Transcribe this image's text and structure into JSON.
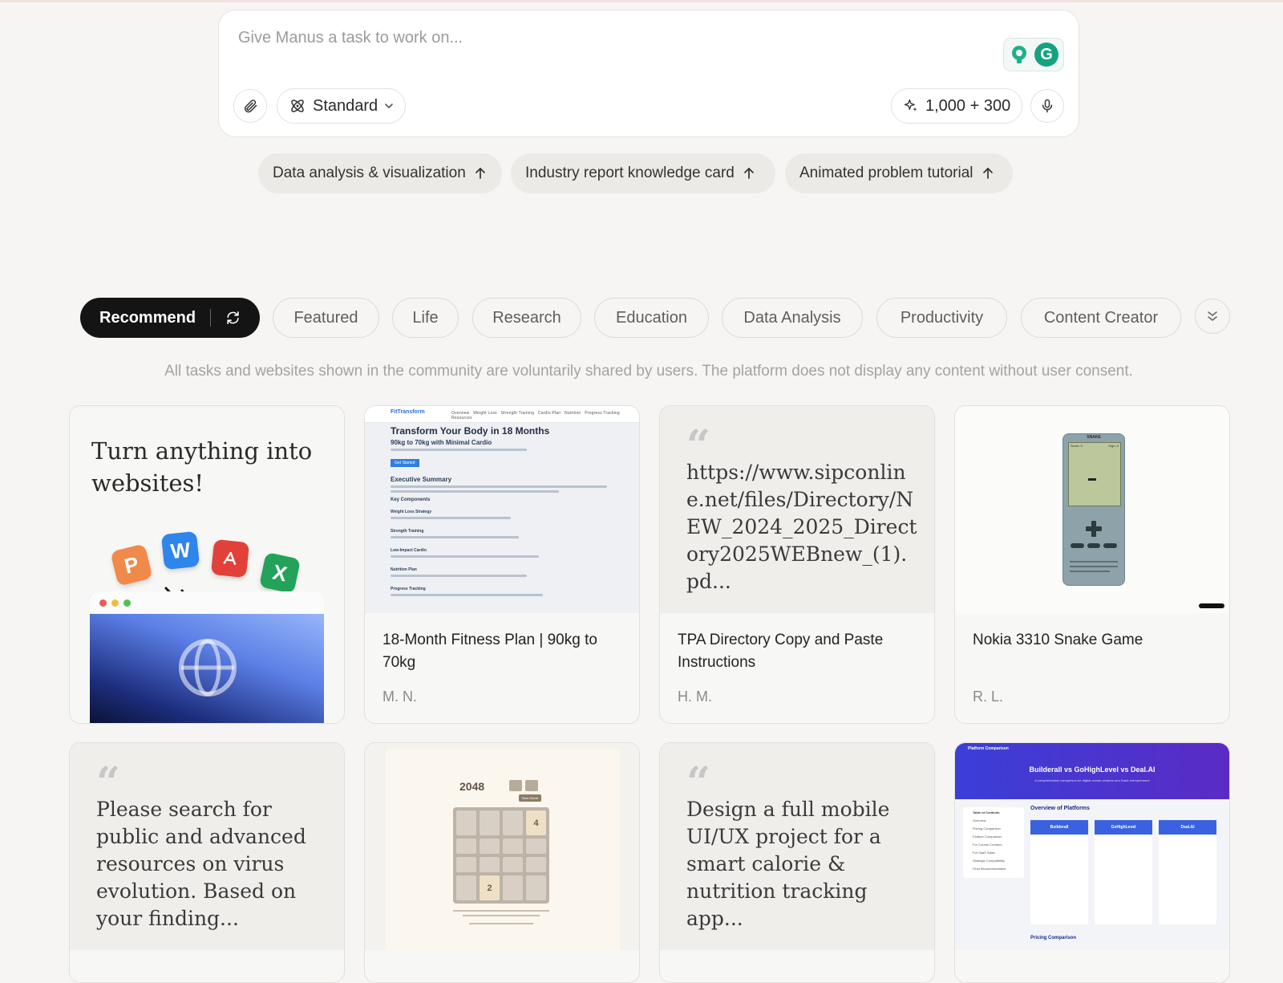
{
  "task_box": {
    "placeholder": "Give Manus a task to work on...",
    "mode_label": "Standard",
    "credits_label": "1,000 + 300"
  },
  "suggestions": [
    {
      "label": "Data analysis & visualization"
    },
    {
      "label": "Industry report knowledge card"
    },
    {
      "label": "Animated problem tutorial"
    }
  ],
  "tabs": {
    "active": "Recommend",
    "items": [
      "Featured",
      "Life",
      "Research",
      "Education",
      "Data Analysis",
      "Productivity",
      "Content Creator"
    ]
  },
  "notice": "All tasks and websites shown in the community are voluntarily shared by users. The platform does not display any content without user consent.",
  "cards": {
    "promo": {
      "title": "Turn anything into websites!",
      "icons": [
        "P",
        "W",
        "X"
      ]
    },
    "fitness": {
      "title": "18-Month Fitness Plan | 90kg to 70kg",
      "author": "M. N.",
      "thumb": {
        "brand": "FitTransform",
        "nav": [
          "Overview",
          "Weight Loss",
          "Strength Training",
          "Cardio Plan",
          "Nutrition",
          "Progress Tracking",
          "Resources"
        ],
        "heading": "Transform Your Body in 18 Months",
        "sub": "90kg to 70kg with Minimal Cardio",
        "button": "Get Started",
        "section": "Executive Summary",
        "components_heading": "Key Components",
        "components": [
          "Weight Loss Strategy",
          "Strength Training",
          "Low-Impact Cardio",
          "Nutrition Plan",
          "Progress Tracking"
        ]
      }
    },
    "tpa": {
      "quote": "https://www.sipconline.net/files/Directory/NEW_2024_2025_Directory2025WEBnew_(1).pd...",
      "title": "TPA Directory Copy and Paste Instructions",
      "author": "H. M."
    },
    "snake": {
      "title": "Nokia 3310 Snake Game",
      "author": "R. L.",
      "thumb": {
        "game_title": "SNAKE",
        "score": "Score: 0",
        "high": "High: 0"
      }
    },
    "virus": {
      "quote": "Please search for public and advanced resources on virus evolution. Based on your finding..."
    },
    "game2048": {
      "title": "2048",
      "new_game": "New Game",
      "tiles": [
        "",
        "",
        "",
        "4",
        "",
        "",
        "",
        "",
        "",
        "",
        "",
        "",
        "",
        "2",
        "",
        ""
      ]
    },
    "calorie": {
      "quote": "Design a full mobile UI/UX project for a smart calorie & nutrition tracking app..."
    },
    "compare": {
      "nav_brand": "Platform Comparison",
      "heading": "Builderall vs GoHighLevel vs Deal.AI",
      "subheading": "A comprehensive comparison for digital course creators and SaaS entrepreneurs",
      "overview": "Overview of Platforms",
      "toc_title": "Table of Contents",
      "toc": [
        "Overview",
        "Pricing Comparison",
        "Feature Comparison",
        "For Course Creators",
        "For SaaS Sales",
        "Strategic Compatibility",
        "Final Recommendation"
      ],
      "platforms": [
        "Builderall",
        "GoHighLevel",
        "Deal.AI"
      ],
      "pricing": "Pricing Comparison"
    }
  }
}
